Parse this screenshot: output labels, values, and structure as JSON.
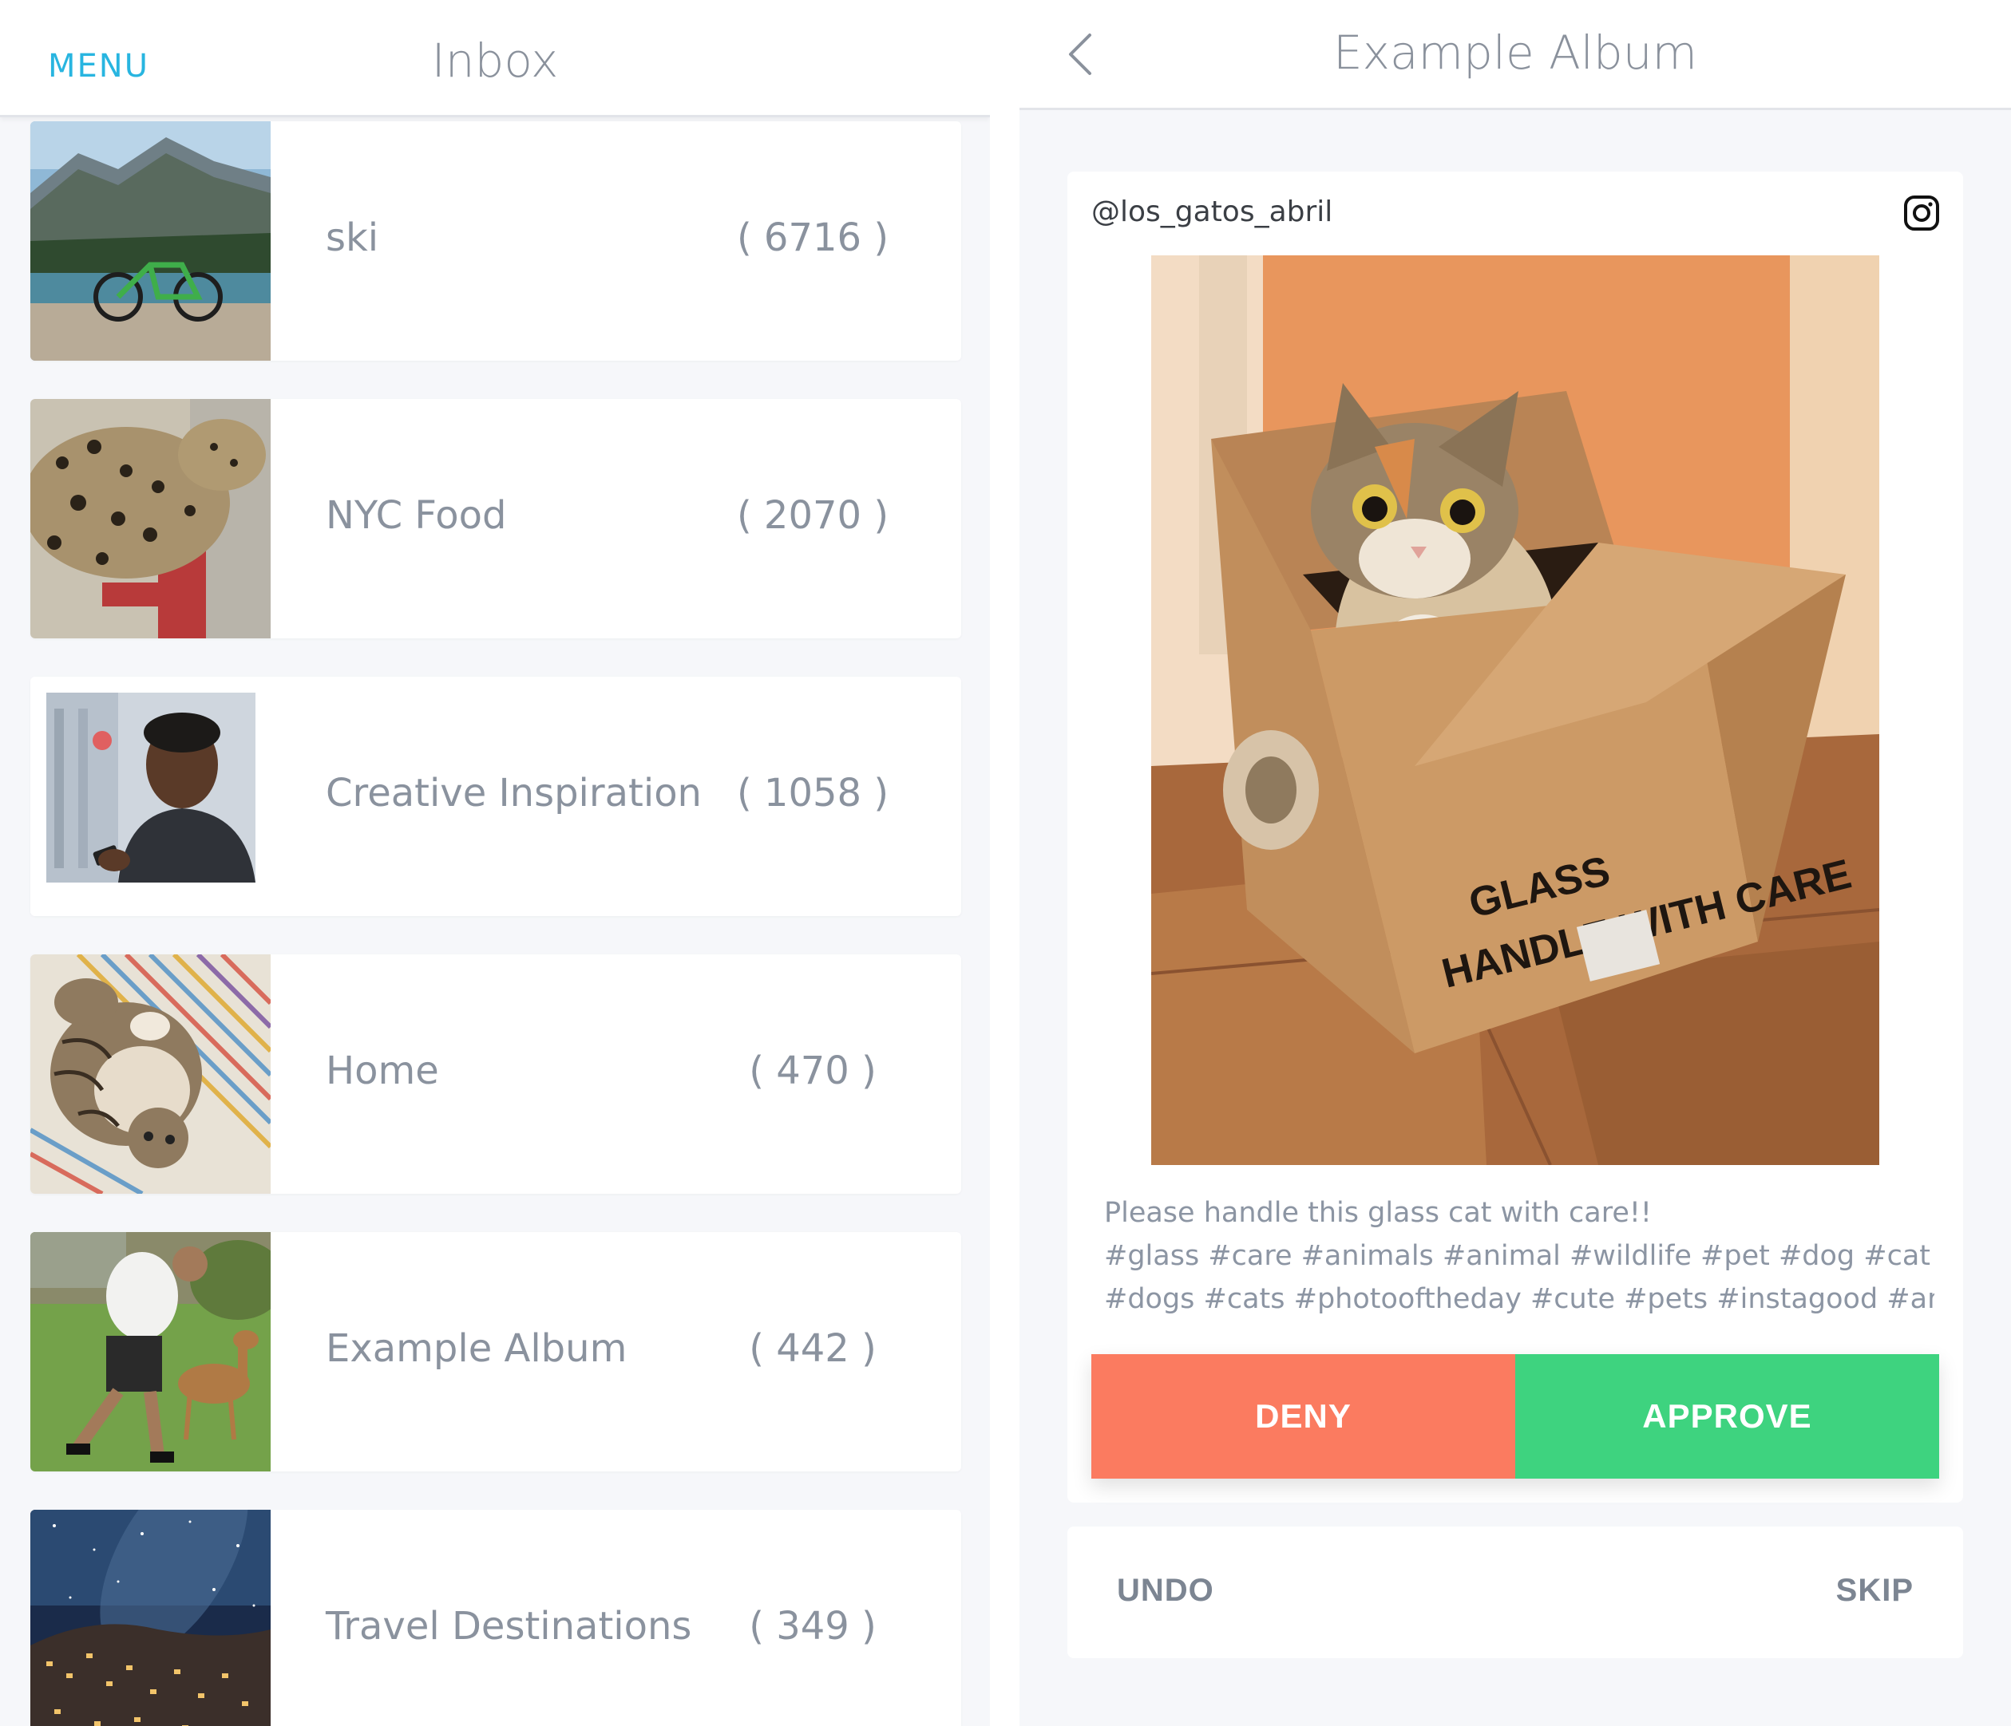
{
  "inbox": {
    "menu_label": "MENU",
    "title": "Inbox",
    "albums": [
      {
        "name": "ski",
        "count": "( 6716 )",
        "thumb": "mountain-lake-bike"
      },
      {
        "name": "NYC Food",
        "count": "( 2070 )",
        "thumb": "spotted-cat"
      },
      {
        "name": "Creative Inspiration",
        "count": "( 1058 )",
        "thumb": "man-with-phone"
      },
      {
        "name": "Home",
        "count": "( 470 )",
        "thumb": "cat-on-blanket"
      },
      {
        "name": "Example Album",
        "count": "( 442 )",
        "thumb": "man-with-deer"
      },
      {
        "name": "Travel Destinations",
        "count": "( 349 )",
        "thumb": "night-city-stars"
      }
    ]
  },
  "album_view": {
    "title": "Example Album",
    "back_icon": "chevron-left-icon",
    "post": {
      "username": "@los_gatos_abril",
      "source_icon": "instagram-icon",
      "photo": "cat-in-cardboard-box",
      "caption_lines": [
        "Please handle this glass cat with care!!",
        "#glass #care #animals #animal #wildlife #pet #dog #cat",
        "#dogs #cats #photooftheday #cute #pets #instagood #anim..."
      ],
      "box_text_line1": "GLASS",
      "box_text_line2": "HANDLE WITH CARE"
    },
    "deny_label": "DENY",
    "approve_label": "APPROVE",
    "undo_label": "UNDO",
    "skip_label": "SKIP"
  },
  "colors": {
    "accent": "#28b5e0",
    "deny": "#fb7b60",
    "approve": "#3ed37f",
    "text_muted": "#8a929e",
    "background": "#f6f7fa"
  }
}
